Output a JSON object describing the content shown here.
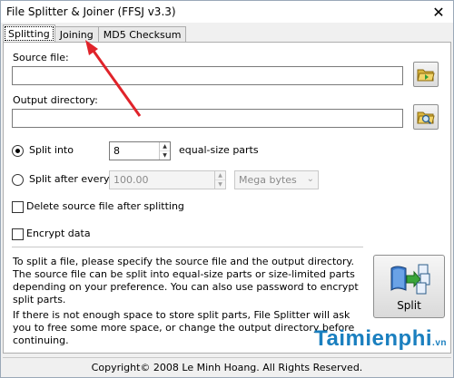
{
  "window": {
    "title": "File Splitter & Joiner (FFSJ v3.3)",
    "close_glyph": "✕"
  },
  "tabs": [
    {
      "label": "Splitting",
      "active": true
    },
    {
      "label": "Joining",
      "active": false
    },
    {
      "label": "MD5 Checksum",
      "active": false
    }
  ],
  "source": {
    "label": "Source file:",
    "value": ""
  },
  "output": {
    "label": "Output directory:",
    "value": ""
  },
  "split_into": {
    "label": "Split into",
    "value": "8",
    "suffix": "equal-size parts",
    "selected": true
  },
  "split_after": {
    "label": "Split after every",
    "value": "100.00",
    "unit": "Mega bytes",
    "selected": false
  },
  "delete_source": {
    "label": "Delete source file after splitting",
    "checked": false
  },
  "encrypt": {
    "label": "Encrypt data",
    "checked": false
  },
  "info": {
    "p1": "To split a file, please specify the source file and the output directory. The source file can be split into equal-size parts or size-limited parts depending on your preference. You can also use password to encrypt split parts.",
    "p2": "If there is not enough space to store split parts, File Splitter will ask you to free some more space, or change the output directory before continuing."
  },
  "split_button": {
    "label": "Split"
  },
  "status": "Copyright© 2008 Le Minh Hoang. All Rights Reserved.",
  "watermark": {
    "brand": "Taimienphi",
    "suffix": ".vn"
  },
  "icons": {
    "source": "folder-open-icon",
    "output": "folder-search-icon",
    "split": "split-files-icon"
  },
  "colors": {
    "annotation_arrow": "#e0232a",
    "watermark": "#1a7fbf"
  }
}
